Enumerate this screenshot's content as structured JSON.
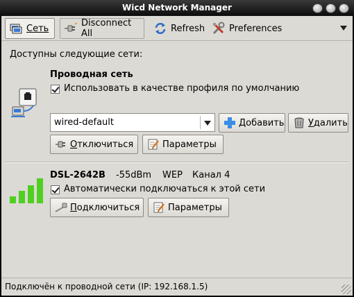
{
  "window": {
    "title": "Wicd Network Manager"
  },
  "toolbar": {
    "network_label": "Сеть",
    "disconnect_all_label": "Disconnect All",
    "refresh_label": "Refresh",
    "preferences_label": "Preferences"
  },
  "main": {
    "available_label": "Доступны следующие сети:",
    "wired": {
      "title": "Проводная сеть",
      "default_profile_label": "Использовать в качестве профиля по умолчанию",
      "default_profile_checked": true,
      "profile_value": "wired-default",
      "add_label": "Добавить",
      "add_mnemonic": "Д",
      "add_rest": "обавить",
      "delete_label": "Удалить",
      "delete_mnemonic": "У",
      "delete_rest": "далить",
      "disconnect_label": "Отключиться",
      "disconnect_mnemonic": "О",
      "disconnect_rest": "тключиться",
      "params_label": "Параметры"
    },
    "wireless": [
      {
        "essid": "DSL-2642B",
        "strength": "-55dBm",
        "encryption": "WEP",
        "channel": "Канал 4",
        "auto_connect_label": "Автоматически подключаться к этой сети",
        "auto_connect_checked": true,
        "connect_label": "Подключиться",
        "connect_mnemonic": "П",
        "connect_rest": "одключиться",
        "params_label": "Параметры"
      }
    ]
  },
  "status": {
    "text": "Подключён к проводной сети (IP: 192.168.1.5)"
  },
  "colors": {
    "signal": "#4fd020",
    "titlebar": "#1a1a1a",
    "background": "#dcdad5"
  }
}
